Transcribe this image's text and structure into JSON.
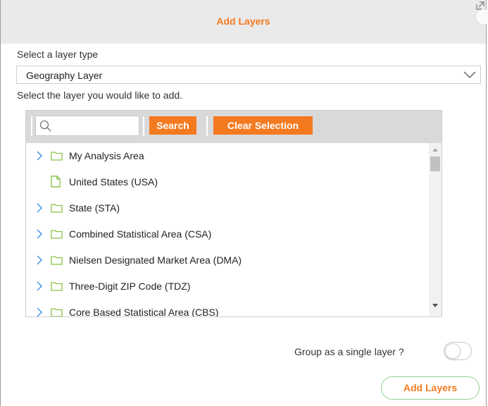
{
  "dialog": {
    "title": "Add Layers",
    "icons": {
      "close": "close-icon",
      "popout": "popout-icon"
    }
  },
  "layer_type": {
    "label": "Select a layer type",
    "selected": "Geography Layer"
  },
  "instruction": "Select the layer you would like to add.",
  "toolbar": {
    "search_placeholder": "",
    "search_value": "",
    "search_label": "Search",
    "clear_label": "Clear Selection"
  },
  "tree": {
    "items": [
      {
        "label": "My Analysis Area",
        "icon": "folder-icon",
        "expandable": true
      },
      {
        "label": "United States (USA)",
        "icon": "document-icon",
        "expandable": false
      },
      {
        "label": "State (STA)",
        "icon": "folder-icon",
        "expandable": true
      },
      {
        "label": "Combined Statistical Area (CSA)",
        "icon": "folder-icon",
        "expandable": true
      },
      {
        "label": "Nielsen Designated Market Area (DMA)",
        "icon": "folder-icon",
        "expandable": true
      },
      {
        "label": "Three-Digit ZIP Code (TDZ)",
        "icon": "folder-icon",
        "expandable": true
      },
      {
        "label": "Core Based Statistical Area (CBS)",
        "icon": "folder-icon",
        "expandable": true
      }
    ]
  },
  "group": {
    "label": "Group as a single layer ?",
    "enabled": false
  },
  "actions": {
    "add_label": "Add Layers"
  },
  "colors": {
    "accent": "#f47a20",
    "folder": "#8bc34a",
    "chevron": "#3a8ee6",
    "titlebar": "#eaeaea"
  }
}
